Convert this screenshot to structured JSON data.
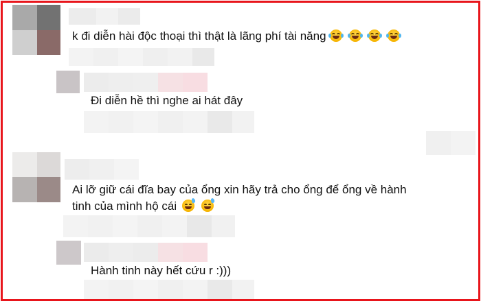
{
  "comments": [
    {
      "text": "k đi diễn hài độc thoại thì thật là lãng phí tài năng",
      "emojis": [
        "face-with-tears-of-joy",
        "face-with-tears-of-joy",
        "face-with-tears-of-joy",
        "face-with-tears-of-joy"
      ],
      "reply": {
        "text": "Đi diễn hề thì nghe ai hát đây"
      }
    },
    {
      "text_line1": "Ai lỡ giữ cái đĩa bay của ổng xin hãy trả cho ổng để ổng về hành",
      "text_line2": "tinh của mình hộ cái",
      "emojis": [
        "grinning-face-with-sweat",
        "grinning-face-with-sweat"
      ],
      "reply": {
        "text": "Hành tinh này hết cứu r :)))"
      }
    }
  ],
  "colors": {
    "frame_border": "#e8151b",
    "pixelation_light": "#eeeeee",
    "pixelation_pink": "#f6dde1"
  }
}
